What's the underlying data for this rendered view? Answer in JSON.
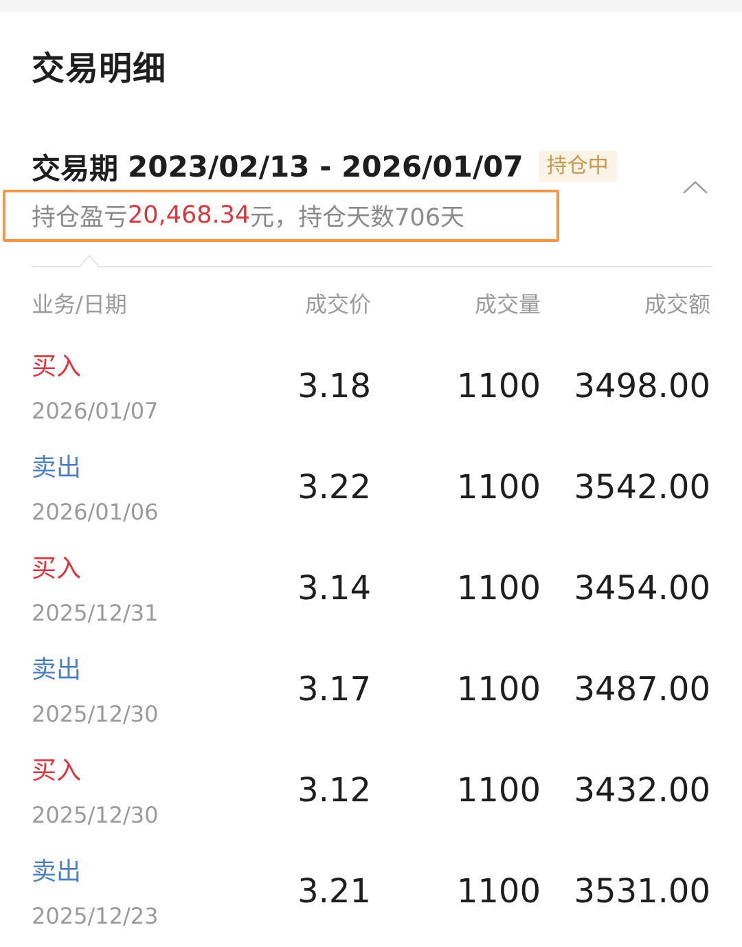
{
  "page": {
    "title": "交易明细"
  },
  "period": {
    "label": "交易期",
    "range": "2023/02/13 - 2026/01/07",
    "status_badge": "持仓中"
  },
  "summary": {
    "profit_prefix": "持仓盈亏",
    "profit_value": "20,468.34",
    "profit_suffix": "元，持仓天数706天"
  },
  "table": {
    "headers": [
      "业务/日期",
      "成交价",
      "成交量",
      "成交额"
    ],
    "rows": [
      {
        "type": "买入",
        "kind": "buy",
        "date": "2026/01/07",
        "price": "3.18",
        "qty": "1100",
        "amount": "3498.00"
      },
      {
        "type": "卖出",
        "kind": "sell",
        "date": "2026/01/06",
        "price": "3.22",
        "qty": "1100",
        "amount": "3542.00"
      },
      {
        "type": "买入",
        "kind": "buy",
        "date": "2025/12/31",
        "price": "3.14",
        "qty": "1100",
        "amount": "3454.00"
      },
      {
        "type": "卖出",
        "kind": "sell",
        "date": "2025/12/30",
        "price": "3.17",
        "qty": "1100",
        "amount": "3487.00"
      },
      {
        "type": "买入",
        "kind": "buy",
        "date": "2025/12/30",
        "price": "3.12",
        "qty": "1100",
        "amount": "3432.00"
      },
      {
        "type": "卖出",
        "kind": "sell",
        "date": "2025/12/23",
        "price": "3.21",
        "qty": "1100",
        "amount": "3531.00"
      }
    ]
  },
  "colors": {
    "buy": "#d9363e",
    "sell": "#4a7fc0",
    "highlight_border": "#f2964a",
    "badge_text": "#c49a4e"
  },
  "icons": {
    "collapse": "chevron-up-icon"
  }
}
